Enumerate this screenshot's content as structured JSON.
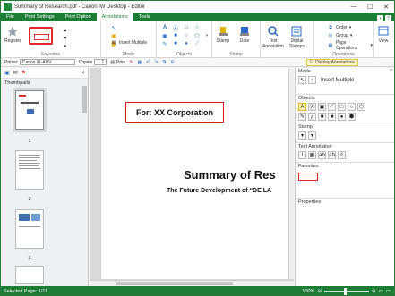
{
  "window": {
    "title": "Summary of Research.pdf - Canon iW Desktop - Editor",
    "controls": [
      "—",
      "☐",
      "✕"
    ]
  },
  "tabs": [
    {
      "label": "File",
      "active": false
    },
    {
      "label": "Print Settings",
      "active": false
    },
    {
      "label": "Print Option",
      "active": false
    },
    {
      "label": "Annotations",
      "active": true
    },
    {
      "label": "Tools",
      "active": false
    }
  ],
  "ribbon": {
    "favorites": {
      "register_label": "Register",
      "group_label": "Favorites"
    },
    "mode": {
      "insert_multiple_label": "Insert Multiple",
      "group_label": "Mode"
    },
    "objects": {
      "group_label": "Objects"
    },
    "stamp": {
      "stamp_label": "Stamp",
      "date_label": "Date",
      "group_label": "Stamp"
    },
    "text": {
      "text_annotation_label": "Text\nAnnotation",
      "digital_stamps_label": "Digital\nStamps"
    },
    "operations": {
      "order_label": "Order",
      "group_label_item": "Group",
      "page_operations_label": "Page Operations",
      "group_label": "Operations"
    },
    "view": {
      "label": "View"
    }
  },
  "toolbar2": {
    "printer_label": "Printer",
    "printer_value": "Canon iR-ADV",
    "copies_label": "Copies",
    "copies_value": "1",
    "print_label": "Print",
    "display_annotations_label": "Display Annotations"
  },
  "thumbnails": {
    "title": "Thumbnails",
    "pages": [
      "1",
      "2",
      "3"
    ]
  },
  "document": {
    "annotation_text": "For: XX Corporation",
    "title": "Summary of Res",
    "subtitle": "The Future Development of “DE LA"
  },
  "right_pane": {
    "mode_title": "Mode",
    "mode_insert_multiple": "Insert Multiple",
    "objects_title": "Objects",
    "stamp_title": "Stamp",
    "text_annotation_title": "Text Annotation",
    "favorites_title": "Favorites",
    "properties_title": "Properties"
  },
  "status": {
    "selected_page": "Selected Page: 1/11",
    "zoom": "100%"
  },
  "colors": {
    "accent_green": "#1e7d34",
    "annotation_red": "#d61b1b"
  }
}
